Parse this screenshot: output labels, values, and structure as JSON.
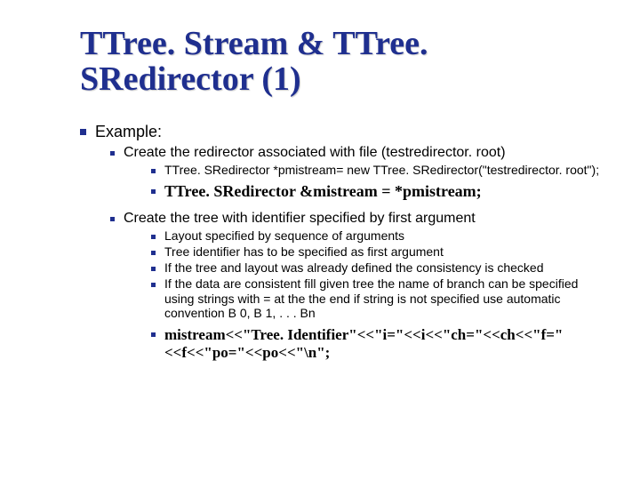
{
  "title": "TTree. Stream & TTree. SRedirector (1)",
  "lvl1": {
    "text": "Example:"
  },
  "sec1": {
    "head": "Create the  redirector associated with file (testredirector. root)",
    "code": " TTree. SRedirector *pmistream= new TTree. SRedirector(\"testredirector. root\");",
    "bold": "TTree. SRedirector &mistream = *pmistream;"
  },
  "sec2": {
    "head": "Create the tree with identifier specified by first argument",
    "b1": "Layout specified by sequence of arguments",
    "b2": "Tree identifier has to be specified as first argument",
    "b3": "If the tree and layout was already defined the consistency is checked",
    "b4": "If the data are consistent fill given tree the name of branch can be specified using strings with = at the the end if string is not specified use automatic convention  B 0, B 1, . . . Bn",
    "code": "  mistream<<\"Tree. Identifier\"<<\"i=\"<<i<<\"ch=\"<<ch<<\"f=\"<<f<<\"po=\"<<po<<\"\\n\";"
  }
}
